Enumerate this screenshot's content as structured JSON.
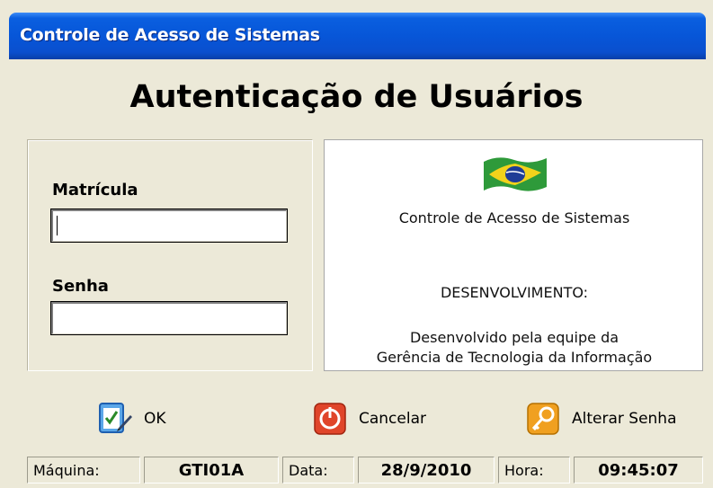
{
  "window": {
    "title": "Controle de Acesso de Sistemas"
  },
  "heading": "Autenticação de Usuários",
  "login": {
    "matricula_label": "Matrícula",
    "matricula_value": "",
    "senha_label": "Senha",
    "senha_value": ""
  },
  "info": {
    "system_name": "Controle de Acesso de Sistemas",
    "section_title": "DESENVOLVIMENTO:",
    "line1": "Desenvolvido pela equipe da",
    "line2": "Gerência de Tecnologia da Informação",
    "flag_icon": "brazil-flag-icon"
  },
  "actions": {
    "ok_label": "OK",
    "cancel_label": "Cancelar",
    "change_password_label": "Alterar Senha"
  },
  "status": {
    "machine_label": "Máquina:",
    "machine_value": "GTI01A",
    "date_label": "Data:",
    "date_value": "28/9/2010",
    "time_label": "Hora:",
    "time_value": "09:45:07"
  },
  "colors": {
    "titlebar": "#0756d8",
    "window_bg": "#ece9d8",
    "cancel_red": "#e0452a",
    "key_orange": "#f0a020"
  }
}
